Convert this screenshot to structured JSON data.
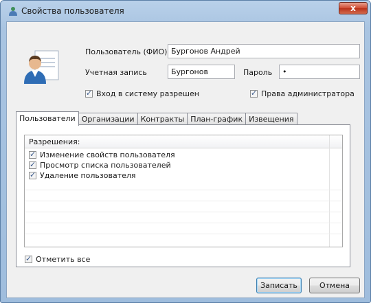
{
  "window": {
    "title": "Свойства пользователя",
    "close_label": "x"
  },
  "form": {
    "user_label": "Пользователь (ФИО)",
    "user_value": "Бургонов Андрей",
    "account_label": "Учетная запись",
    "account_value": "Бургонов",
    "password_label": "Пароль",
    "password_value": "•",
    "login_allowed_label": "Вход в систему разрешен",
    "admin_rights_label": "Права администратора"
  },
  "tabs": [
    "Пользователи",
    "Организации",
    "Контракты",
    "План-график",
    "Извещения"
  ],
  "permissions": {
    "header": "Разрешения:",
    "items": [
      "Изменение свойств пользователя",
      "Просмотр списка пользователей",
      "Удаление пользователя"
    ]
  },
  "select_all_label": "Отметить все",
  "buttons": {
    "save": "Записать",
    "cancel": "Отмена"
  }
}
